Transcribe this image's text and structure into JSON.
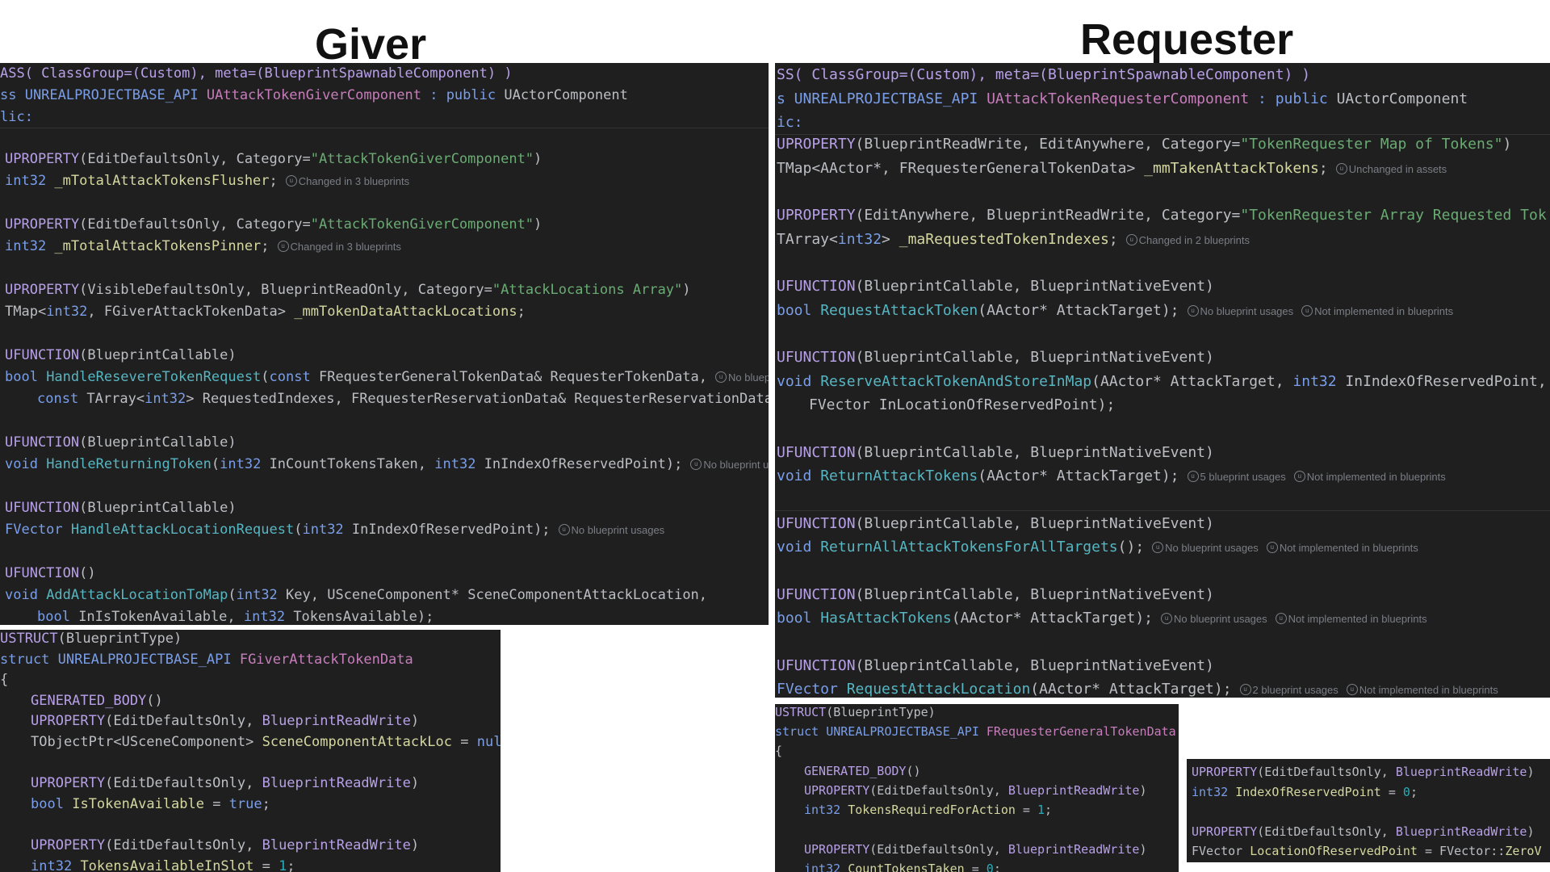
{
  "headings": {
    "giver": "Giver",
    "requester": "Requester"
  },
  "hints": {
    "changed3": "Changed in 3 blueprints",
    "changed2": "Changed in 2 blueprints",
    "unchanged": "Unchanged in assets",
    "no_usages": "No blueprint usages",
    "not_impl": "Not implemented in blueprints",
    "five_usages": "5 blueprint usages",
    "two_usages": "2 blueprint usages",
    "no_bp_trunc": "No blueprint",
    "no_bp_usag_trunc": "No blueprint usag"
  },
  "giver_code": {
    "l1": [
      "ASS( ClassGroup=(Custom), meta=(BlueprintSpawnableComponent) )"
    ],
    "l2": [
      "ss UNREALPROJECTBASE_API ",
      "UAttackTokenGiverComponent",
      " : public ",
      "UActorComponent"
    ],
    "l3": [
      "lic:"
    ],
    "p1": [
      "UPROPERTY",
      "(EditDefaultsOnly, Category=",
      "\"AttackTokenGiverComponent\"",
      ")"
    ],
    "p1d": [
      "int32",
      " _mTotalAttackTokensFlusher",
      ";"
    ],
    "p2": [
      "UPROPERTY",
      "(EditDefaultsOnly, Category=",
      "\"AttackTokenGiverComponent\"",
      ")"
    ],
    "p2d": [
      "int32",
      " _mTotalAttackTokensPinner",
      ";"
    ],
    "p3": [
      "UPROPERTY",
      "(VisibleDefaultsOnly, BlueprintReadOnly, Category=",
      "\"AttackLocations Array\"",
      ")"
    ],
    "p3d": [
      "TMap<",
      "int32",
      ", FGiverAttackTokenData> ",
      "_mmTokenDataAttackLocations",
      ";"
    ],
    "f1": [
      "UFUNCTION",
      "(BlueprintCallable)"
    ],
    "f1d": [
      "bool ",
      "HandleResevereTokenRequest",
      "(",
      "const",
      " FRequesterGeneralTokenData& RequesterTokenData,"
    ],
    "f1d2": [
      "const",
      " TArray<",
      "int32",
      "> RequestedIndexes, FRequesterReservationData& RequesterReservationData);"
    ],
    "f2": [
      "UFUNCTION",
      "(BlueprintCallable)"
    ],
    "f2d": [
      "void ",
      "HandleReturningToken",
      "(",
      "int32",
      " InCountTokensTaken, ",
      "int32",
      " InIndexOfReservedPoint);"
    ],
    "f3": [
      "UFUNCTION",
      "(BlueprintCallable)"
    ],
    "f3d": [
      "FVector ",
      "HandleAttackLocationRequest",
      "(",
      "int32",
      " InIndexOfReservedPoint);"
    ],
    "f4": [
      "UFUNCTION",
      "()"
    ],
    "f4d": [
      "void ",
      "AddAttackLocationToMap",
      "(",
      "int32",
      " Key, ",
      "USceneComponent",
      "* SceneComponentAttackLocation,"
    ],
    "f4d2": [
      "bool",
      " InIsTokenAvailable, ",
      "int32",
      " TokensAvailable);"
    ]
  },
  "giver_struct": {
    "l1": [
      "USTRUCT",
      "(BlueprintType)"
    ],
    "l2": [
      "struct",
      " UNREALPROJECTBASE_API ",
      "FGiverAttackTokenData"
    ],
    "l3": [
      "{"
    ],
    "l4": [
      "GENERATED_BODY",
      "()"
    ],
    "l5": [
      "UPROPERTY",
      "(EditDefaultsOnly, ",
      "BlueprintReadWrite",
      ")"
    ],
    "l6": [
      "TObjectPtr<",
      "USceneComponent",
      "> ",
      "SceneComponentAttackLoc",
      " = ",
      "nullptr"
    ],
    "l7": [
      "UPROPERTY",
      "(EditDefaultsOnly, ",
      "BlueprintReadWrite",
      ")"
    ],
    "l8": [
      "bool",
      " ",
      "IsTokenAvailable",
      " = ",
      "true",
      ";"
    ],
    "l9": [
      "UPROPERTY",
      "(EditDefaultsOnly, ",
      "BlueprintReadWrite",
      ")"
    ],
    "l10": [
      "int32",
      " ",
      "TokensAvailableInSlot",
      " = ",
      "1",
      ";"
    ]
  },
  "req_code": {
    "l1": [
      "SS( ClassGroup=(Custom), meta=(BlueprintSpawnableComponent) )"
    ],
    "l2": [
      "s UNREALPROJECTBASE_API ",
      "UAttackTokenRequesterComponent",
      " : public ",
      "UActorComponent"
    ],
    "l3": [
      "ic:"
    ],
    "p1": [
      "UPROPERTY",
      "(BlueprintReadWrite, EditAnywhere, Category=",
      "\"TokenRequester Map of Tokens\"",
      ")"
    ],
    "p1d": [
      "TMap<AActor*, FRequesterGeneralTokenData> ",
      "_mmTakenAttackTokens",
      ";"
    ],
    "p2": [
      "UPROPERTY",
      "(EditAnywhere, BlueprintReadWrite, Category=",
      "\"TokenRequester Array Requested Tok"
    ],
    "p2d": [
      "TArray<",
      "int32",
      "> ",
      "_maRequestedTokenIndexes",
      ";"
    ],
    "f1": [
      "UFUNCTION",
      "(BlueprintCallable, BlueprintNativeEvent)"
    ],
    "f1d": [
      "bool ",
      "RequestAttackToken",
      "(AActor* AttackTarget);"
    ],
    "f2": [
      "UFUNCTION",
      "(BlueprintCallable, BlueprintNativeEvent)"
    ],
    "f2d": [
      "void ",
      "ReserveAttackTokenAndStoreInMap",
      "(AActor* AttackTarget, ",
      "int32",
      " InIndexOfReservedPoint,"
    ],
    "f2d2": [
      "FVector InLocationOfReservedPoint);"
    ],
    "f3": [
      "UFUNCTION",
      "(BlueprintCallable, BlueprintNativeEvent)"
    ],
    "f3d": [
      "void ",
      "ReturnAttackTokens",
      "(AActor* AttackTarget);"
    ],
    "f4": [
      "UFUNCTION",
      "(BlueprintCallable, BlueprintNativeEvent)"
    ],
    "f4d": [
      "void ",
      "ReturnAllAttackTokensForAllTargets",
      "();"
    ],
    "f5": [
      "UFUNCTION",
      "(BlueprintCallable, BlueprintNativeEvent)"
    ],
    "f5d": [
      "bool ",
      "HasAttackTokens",
      "(AActor* AttackTarget);"
    ],
    "f6": [
      "UFUNCTION",
      "(BlueprintCallable, BlueprintNativeEvent)"
    ],
    "f6d": [
      "FVector ",
      "RequestAttackLocation",
      "(AActor* AttackTarget);"
    ]
  },
  "req_struct": {
    "l1": [
      "USTRUCT",
      "(BlueprintType)"
    ],
    "l2": [
      "struct",
      " UNREALPROJECTBASE_API ",
      "FRequesterGeneralTokenData"
    ],
    "l3": [
      "{"
    ],
    "l4": [
      "GENERATED_BODY",
      "()"
    ],
    "l5": [
      "UPROPERTY",
      "(EditDefaultsOnly, ",
      "BlueprintReadWrite",
      ")"
    ],
    "l6": [
      "int32",
      " ",
      "TokensRequiredForAction",
      " = ",
      "1",
      ";"
    ],
    "l7": [
      "UPROPERTY",
      "(EditDefaultsOnly, ",
      "BlueprintReadWrite",
      ")"
    ],
    "l8": [
      "int32",
      " ",
      "CountTokensTaken",
      " = ",
      "0",
      ";"
    ]
  },
  "req_struct2": {
    "l1": [
      "UPROPERTY",
      "(EditDefaultsOnly, ",
      "BlueprintReadWrite",
      ")"
    ],
    "l2": [
      "int32",
      " ",
      "IndexOfReservedPoint",
      " = ",
      "0",
      ";"
    ],
    "l3": [
      "UPROPERTY",
      "(EditDefaultsOnly, ",
      "BlueprintReadWrite",
      ")"
    ],
    "l4": [
      "FVector ",
      "LocationOfReservedPoint",
      " = FVector::",
      "ZeroV"
    ]
  }
}
